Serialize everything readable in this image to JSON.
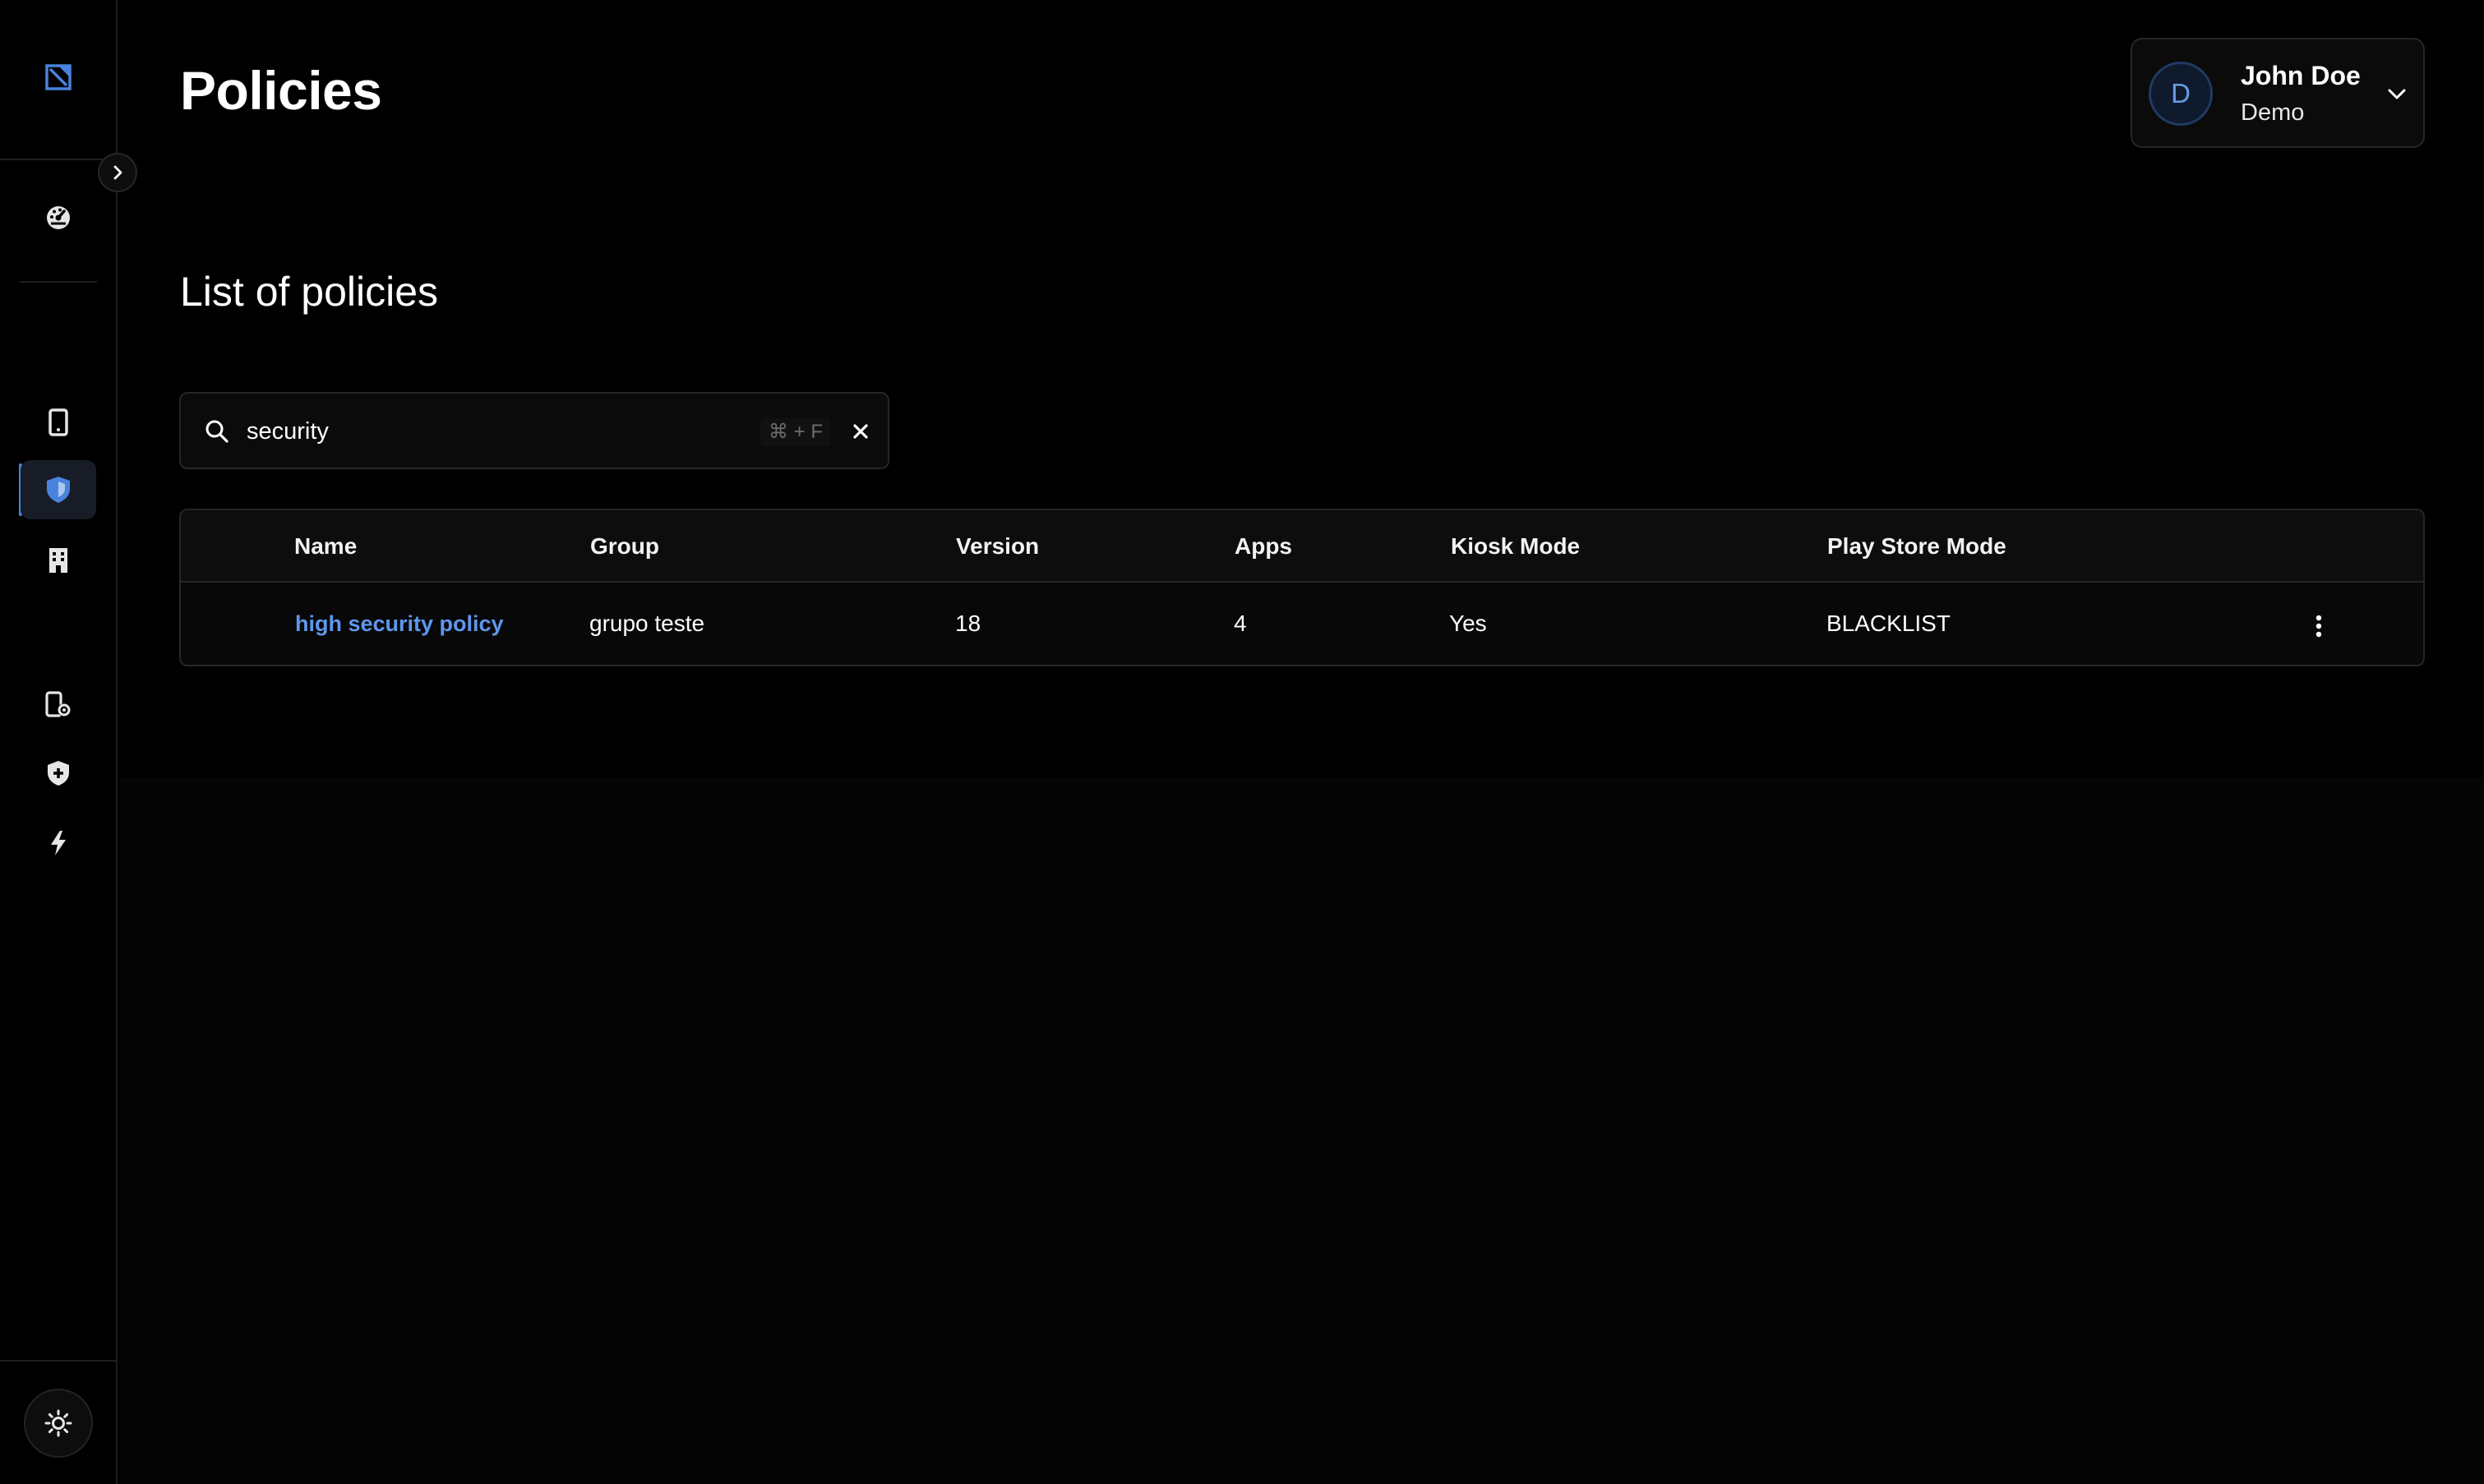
{
  "page": {
    "title": "Policies",
    "section_title": "List of policies"
  },
  "user": {
    "avatar_initial": "D",
    "name": "John Doe",
    "organization": "Demo"
  },
  "sidebar": {
    "items": [
      {
        "name": "logo",
        "icon": "logo-icon"
      },
      {
        "name": "dashboard",
        "icon": "gauge-icon"
      },
      {
        "name": "devices",
        "icon": "smartphone-icon"
      },
      {
        "name": "policies",
        "icon": "shield-icon",
        "active": true
      },
      {
        "name": "enterprise",
        "icon": "building-icon"
      },
      {
        "name": "device-settings",
        "icon": "phone-gear-icon"
      },
      {
        "name": "security",
        "icon": "shield-plus-icon"
      },
      {
        "name": "automation",
        "icon": "lightning-icon"
      }
    ],
    "theme_toggle_icon": "sun-icon"
  },
  "search": {
    "value": "security",
    "shortcut": "⌘ + F"
  },
  "table": {
    "columns": [
      "Name",
      "Group",
      "Version",
      "Apps",
      "Kiosk Mode",
      "Play Store Mode"
    ],
    "rows": [
      {
        "name": "high security policy",
        "group": "grupo teste",
        "version": "18",
        "apps": "4",
        "kiosk_mode": "Yes",
        "play_store_mode": "BLACKLIST"
      }
    ]
  },
  "colors": {
    "accent": "#4a83dd",
    "link": "#5e97ec",
    "background": "#000000",
    "border": "#262626"
  }
}
